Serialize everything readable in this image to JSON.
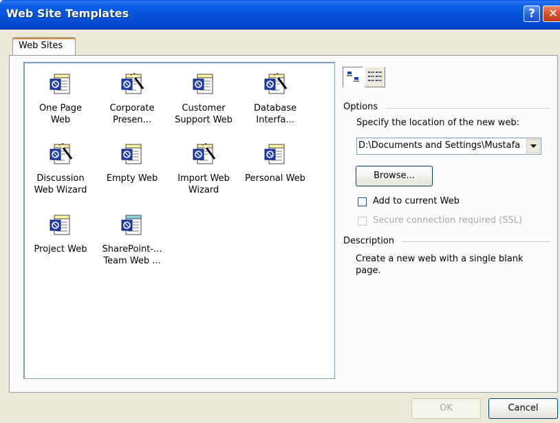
{
  "window": {
    "title": "Web Site Templates"
  },
  "tabs": [
    {
      "label": "Web Sites",
      "active": true
    }
  ],
  "templates": [
    {
      "label_line1": "One Page",
      "label_line2": "Web",
      "icon": "web-page-icon"
    },
    {
      "label_line1": "Corporate",
      "label_line2": "Presen...",
      "icon": "wizard-web-icon"
    },
    {
      "label_line1": "Customer",
      "label_line2": "Support Web",
      "icon": "web-page-icon"
    },
    {
      "label_line1": "Database",
      "label_line2": "Interfa...",
      "icon": "wizard-web-icon"
    },
    {
      "label_line1": "Discussion",
      "label_line2": "Web Wizard",
      "icon": "wizard-web-icon"
    },
    {
      "label_line1": "Empty Web",
      "label_line2": "",
      "icon": "web-page-icon"
    },
    {
      "label_line1": "Import Web",
      "label_line2": "Wizard",
      "icon": "wizard-web-icon"
    },
    {
      "label_line1": "Personal Web",
      "label_line2": "",
      "icon": "web-page-icon"
    },
    {
      "label_line1": "Project Web",
      "label_line2": "",
      "icon": "web-page-icon"
    },
    {
      "label_line1": "SharePoint-...",
      "label_line2": "Team Web ...",
      "icon": "sharepoint-web-icon"
    }
  ],
  "view_buttons": [
    {
      "name": "large-icons-view-icon",
      "pressed": true
    },
    {
      "name": "list-view-icon",
      "pressed": false
    }
  ],
  "options": {
    "heading": "Options",
    "location_label": "Specify the location of the new web:",
    "location_value": "D:\\Documents and Settings\\Mustafa",
    "browse_label": "Browse...",
    "add_to_current_label": "Add to current Web",
    "add_to_current_checked": false,
    "ssl_label": "Secure connection required (SSL)",
    "ssl_checked": false,
    "ssl_enabled": false
  },
  "description": {
    "heading": "Description",
    "text_line1": "Create a new web with a single blank",
    "text_line2": "page."
  },
  "footer": {
    "ok_label": "OK",
    "cancel_label": "Cancel"
  },
  "colors": {
    "titlebar": "#0452d8",
    "accent_tab": "#e68b2c",
    "dialog_bg": "#ece9d8"
  }
}
